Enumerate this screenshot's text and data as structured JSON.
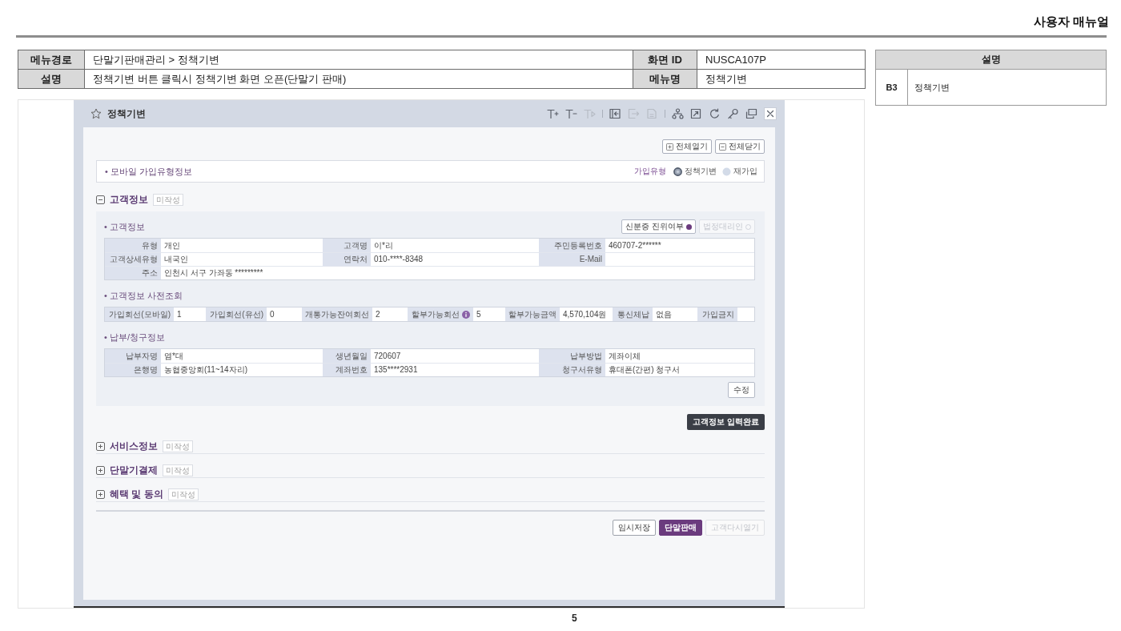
{
  "manual_title": "사용자 매뉴얼",
  "info_table": {
    "rows": [
      [
        {
          "label": "메뉴경로",
          "value": "단말기판매관리 > 정책기변"
        },
        {
          "label": "화면 ID",
          "value": "NUSCA107P"
        }
      ],
      [
        {
          "label": "설명",
          "value": "정책기변 버튼 클릭시 정책기변 화면 오픈(단말기 판매)"
        },
        {
          "label": "메뉴명",
          "value": "정책기변"
        }
      ]
    ]
  },
  "description_table": {
    "heading": "설명",
    "rows": [
      {
        "marker": "B3",
        "text": "정책기변"
      }
    ]
  },
  "window": {
    "title": "정책기변",
    "toolbar": [
      {
        "kind": "text-increase",
        "disabled": false
      },
      {
        "kind": "text-decrease",
        "disabled": false
      },
      {
        "kind": "text-reset",
        "disabled": true
      },
      {
        "kind": "separator"
      },
      {
        "kind": "dock-left",
        "disabled": false
      },
      {
        "kind": "export",
        "disabled": true
      },
      {
        "kind": "document",
        "disabled": true
      },
      {
        "kind": "separator"
      },
      {
        "kind": "hierarchy",
        "disabled": false
      },
      {
        "kind": "expand-box",
        "disabled": false
      },
      {
        "kind": "refresh",
        "disabled": false
      },
      {
        "kind": "key",
        "disabled": false
      },
      {
        "kind": "popup",
        "disabled": false
      },
      {
        "kind": "close",
        "disabled": false
      }
    ],
    "expand_buttons": [
      {
        "kind": "expand",
        "label": "전체열기"
      },
      {
        "kind": "collapse",
        "label": "전체닫기"
      }
    ],
    "join_type": {
      "title": "• 모바일 가입유형정보",
      "label": "가입유형",
      "options": [
        {
          "label": "정책기변",
          "selected": true
        },
        {
          "label": "재가입",
          "selected": false
        }
      ]
    },
    "sections": [
      {
        "title": "고객정보",
        "status": "미작성",
        "expanded": true,
        "groups": [
          {
            "title": "• 고객정보",
            "actions": [
              {
                "label": "신분증 진위여부",
                "checked": true,
                "disabled": false
              },
              {
                "label": "법정대리인",
                "checked": false,
                "disabled": true
              }
            ],
            "rows": [
              [
                {
                  "label": "유형",
                  "value": "개인"
                },
                {
                  "label": "고객명",
                  "value": "이*리"
                },
                {
                  "label": "주민등록번호",
                  "value": "460707-2******"
                }
              ],
              [
                {
                  "label": "고객상세유형",
                  "value": "내국인"
                },
                {
                  "label": "연락처",
                  "value": "010-****-8348"
                },
                {
                  "label": "E-Mail"
                }
              ],
              [
                {
                  "label": "주소",
                  "value": "인천시 서구 가좌동 *********"
                }
              ]
            ]
          },
          {
            "title": "• 고객정보 사전조회",
            "rows": [
              [
                {
                  "label": "가입회선(모바일)",
                  "value": "1"
                },
                {
                  "label": "가입회선(유선)",
                  "value": "0"
                },
                {
                  "label": "개통가능잔여회선",
                  "value": "2"
                },
                {
                  "label": "할부가능회선",
                  "value": "5",
                  "info": true
                },
                {
                  "label": "할부가능금액",
                  "value": "4,570,104원"
                },
                {
                  "label": "통신체납",
                  "value": "없음"
                },
                {
                  "label": "가입금지"
                }
              ]
            ]
          },
          {
            "title": "• 납부/청구정보",
            "rows": [
              [
                {
                  "label": "납부자명",
                  "value": "염*대"
                },
                {
                  "label": "생년월일",
                  "value": "720607"
                },
                {
                  "label": "납부방법",
                  "value": "계좌이체"
                }
              ],
              [
                {
                  "label": "은행명",
                  "value": "농협중앙회(11~14자리)"
                },
                {
                  "label": "계좌번호",
                  "value": "135****2931"
                },
                {
                  "label": "청구서유형",
                  "value": "휴대폰(간편) 청구서"
                }
              ]
            ],
            "button": "수정"
          }
        ],
        "complete_button": "고객정보 입력완료"
      },
      {
        "title": "서비스정보",
        "status": "미작성",
        "expanded": false
      },
      {
        "title": "단말기결제",
        "status": "미작성",
        "expanded": false
      },
      {
        "title": "혜택 및 동의",
        "status": "미작성",
        "expanded": false
      }
    ],
    "footer_buttons": [
      {
        "label": "임시저장",
        "kind": "default",
        "disabled": false
      },
      {
        "label": "단말판매",
        "kind": "primary",
        "disabled": false
      },
      {
        "label": "고객다시열기",
        "kind": "default",
        "disabled": true
      }
    ]
  },
  "page_number": "5"
}
